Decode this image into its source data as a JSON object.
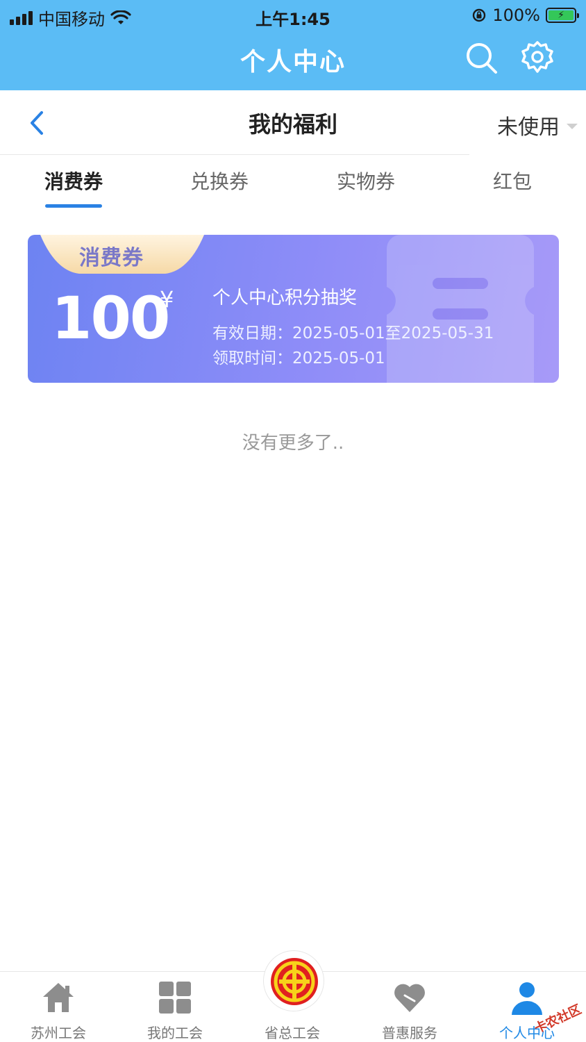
{
  "status_bar": {
    "carrier": "中国移动",
    "time": "上午1:45",
    "battery": "100%"
  },
  "app_header": {
    "title": "个人中心",
    "icons": [
      "search-icon",
      "settings-gear-icon"
    ]
  },
  "page_header": {
    "title": "我的福利",
    "filter_label": "未使用"
  },
  "tabs": [
    {
      "label": "消费券",
      "active": true
    },
    {
      "label": "兑换券",
      "active": false
    },
    {
      "label": "实物券",
      "active": false
    },
    {
      "label": "红包",
      "active": false
    }
  ],
  "coupon": {
    "type_label": "消费券",
    "amount": "100",
    "currency": "¥",
    "title": "个人中心积分抽奖",
    "valid_date": "有效日期：2025-05-01至2025-05-31",
    "received_time": "领取时间：2025-05-01"
  },
  "list_end_text": "没有更多了..",
  "bottom_nav": [
    {
      "label": "苏州工会",
      "icon": "home-icon",
      "active": false
    },
    {
      "label": "我的工会",
      "icon": "grid-icon",
      "active": false
    },
    {
      "label": "省总工会",
      "icon": "union-logo-icon",
      "active": false
    },
    {
      "label": "普惠服务",
      "icon": "heart-icon",
      "active": false
    },
    {
      "label": "个人中心",
      "icon": "person-icon",
      "active": true
    }
  ],
  "watermark": "卡农社区",
  "colors": {
    "header_blue": "#5bbcf5",
    "accent_blue": "#1e88e5",
    "tab_underline": "#2a82e4",
    "card_start": "#6d83f2",
    "card_end": "#a79af8"
  }
}
